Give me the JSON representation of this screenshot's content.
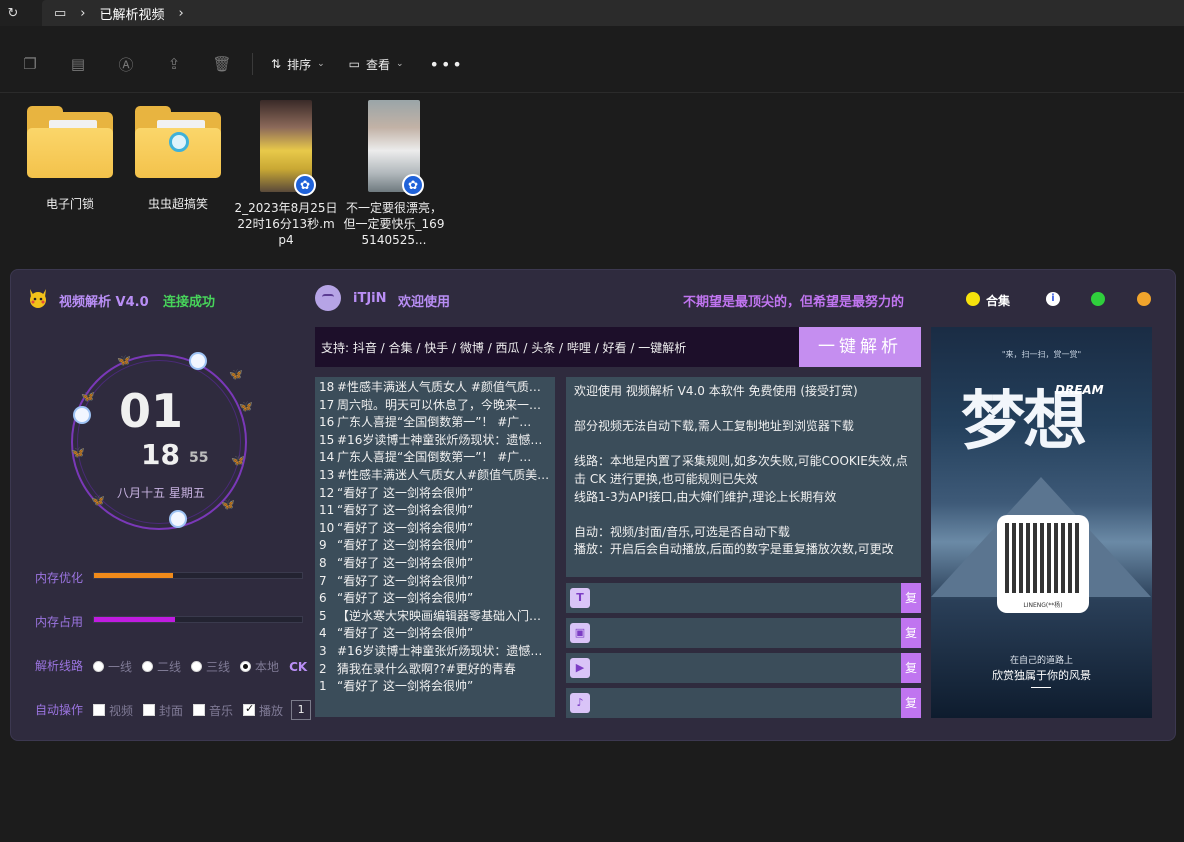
{
  "explorer": {
    "breadcrumb": "已解析视频",
    "toolbar": {
      "sort_label": "排序",
      "view_label": "查看"
    },
    "files": [
      {
        "name": "电子门锁",
        "type": "folder"
      },
      {
        "name": "虫虫超搞笑",
        "type": "folder"
      },
      {
        "name": "2_2023年8月25日22时16分13秒.mp4",
        "type": "video"
      },
      {
        "name": "不一定要很漂亮，但一定要快乐_1695140525...",
        "type": "video"
      }
    ]
  },
  "app": {
    "title": "视频解析 V4.0",
    "status": "连接成功",
    "user": "iTJiN",
    "welcome": "欢迎使用",
    "motto": "不期望是最顶尖的，但希望是最努力的",
    "collection_label": "合集",
    "info_icon": "i",
    "clock": {
      "hour": "01",
      "minute": "18",
      "second": "55",
      "date": "八月十五 星期五"
    },
    "memory_opt_label": "内存优化",
    "memory_opt_level": 0.38,
    "memory_use_label": "内存占用",
    "memory_use_level": 0.39,
    "line_label": "解析线路",
    "lines": [
      "一线",
      "二线",
      "三线",
      "本地"
    ],
    "selected_line": "本地",
    "ck_label": "CK",
    "auto_label": "自动操作",
    "auto_options": [
      {
        "label": "视频",
        "checked": false
      },
      {
        "label": "封面",
        "checked": false
      },
      {
        "label": "音乐",
        "checked": false
      },
      {
        "label": "播放",
        "checked": true
      }
    ],
    "play_count": "1",
    "support_text": "支持: 抖音 / 合集 / 快手 / 微博 / 西瓜 / 头条 / 哔哩 / 好看 / 一键解析",
    "parse_button": "一键解析",
    "history": [
      {
        "n": "18",
        "t": "#性感丰满迷人气质女人 #颜值气质…"
      },
      {
        "n": "17",
        "t": "周六啦。明天可以休息了，今晚来一…"
      },
      {
        "n": "16",
        "t": "广东人喜提“全国倒数第一”！ #广…"
      },
      {
        "n": "15",
        "t": "#16岁读博士神童张炘炀现状：遗憾…"
      },
      {
        "n": "14",
        "t": "广东人喜提“全国倒数第一”！ #广…"
      },
      {
        "n": "13",
        "t": "#性感丰满迷人气质女人#颜值气质美…"
      },
      {
        "n": "12",
        "t": "“看好了 这一剑将会很帅”"
      },
      {
        "n": "11",
        "t": "“看好了 这一剑将会很帅”"
      },
      {
        "n": "10",
        "t": "“看好了 这一剑将会很帅”"
      },
      {
        "n": "9",
        "t": "“看好了 这一剑将会很帅”"
      },
      {
        "n": "8",
        "t": "“看好了 这一剑将会很帅”"
      },
      {
        "n": "7",
        "t": "“看好了 这一剑将会很帅”"
      },
      {
        "n": "6",
        "t": "“看好了 这一剑将会很帅”"
      },
      {
        "n": "5",
        "t": "【逆水寒大宋映画编辑器零基础入门…"
      },
      {
        "n": "4",
        "t": "“看好了 这一剑将会很帅”"
      },
      {
        "n": "3",
        "t": "#16岁读博士神童张炘炀现状：遗憾…"
      },
      {
        "n": "2",
        "t": "猜我在录什么歌啊??#更好的青春"
      },
      {
        "n": "1",
        "t": "“看好了 这一剑将会很帅”"
      }
    ],
    "notice": "欢迎使用 视频解析 V4.0 本软件 免费使用 (接受打赏)\n\n部分视频无法自动下载,需人工复制地址到浏览器下载\n\n线路：本地是内置了采集规则,如多次失败,可能COOKIE失效,点击 CK 进行更换,也可能规则已失效\n线路1-3为API接口,由大婶们维护,理论上长期有效\n\n自动：视频/封面/音乐,可选是否自动下载\n播放：开启后会自动播放,后面的数字是重复播放次数,可更改",
    "copy_label": "复",
    "outputs": [
      {
        "icon": "title-icon",
        "glyph": "T"
      },
      {
        "icon": "image-icon",
        "glyph": "▣"
      },
      {
        "icon": "video-icon",
        "glyph": "▶"
      },
      {
        "icon": "music-icon",
        "glyph": "♪"
      }
    ],
    "poster": {
      "tagline": "\"来，扫一扫，赏一赏\"",
      "dream": "DREAM",
      "big": "梦想",
      "qr_label": "LINENG(**杨)",
      "line1": "在自己的道路上",
      "line2": "欣赏独属于你的风景"
    }
  },
  "colors": {
    "accent": "#c58ef0",
    "status_green": "#47d45a",
    "panel": "#3b4d5a",
    "window": "#2f2b3e"
  }
}
